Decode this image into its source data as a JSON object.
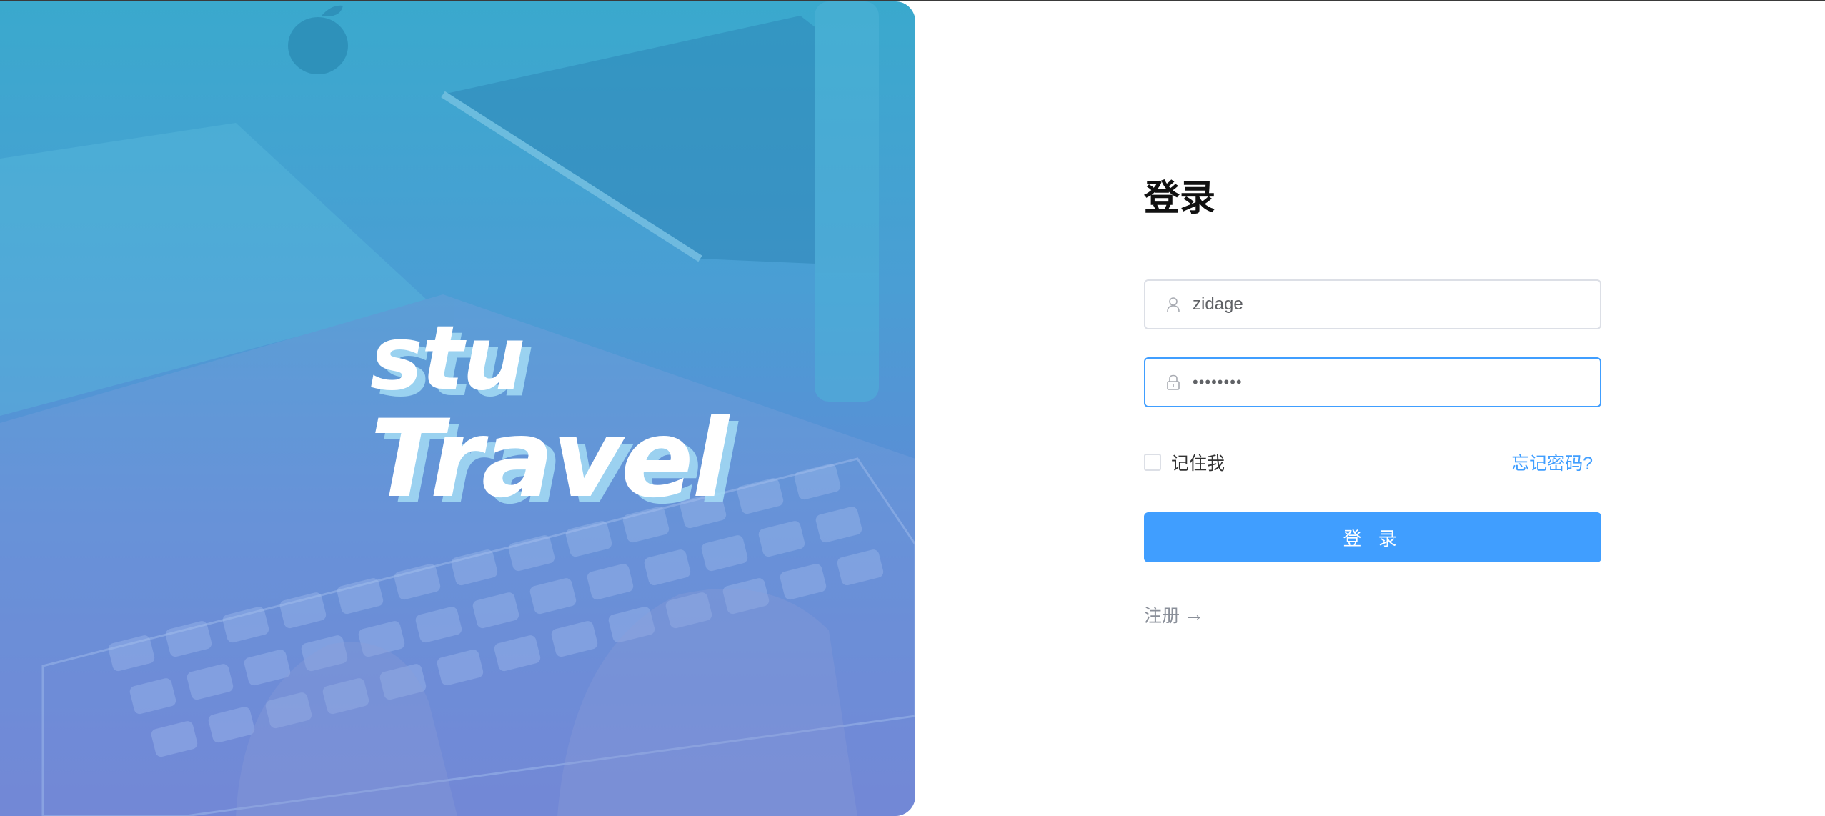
{
  "hero": {
    "brand_line1": "stu",
    "brand_line2": "Travel"
  },
  "login": {
    "title": "登录",
    "username": {
      "value": "zidage",
      "icon": "user-icon"
    },
    "password": {
      "value": "abcd1234",
      "icon": "lock-icon"
    },
    "remember_label": "记住我",
    "forgot_label": "忘记密码?",
    "submit_label": "登 录",
    "register_label": "注册",
    "register_arrow": "→"
  },
  "colors": {
    "primary": "#409eff",
    "hero_top": "#3aa9cd",
    "hero_bottom": "#6f7bd3"
  }
}
